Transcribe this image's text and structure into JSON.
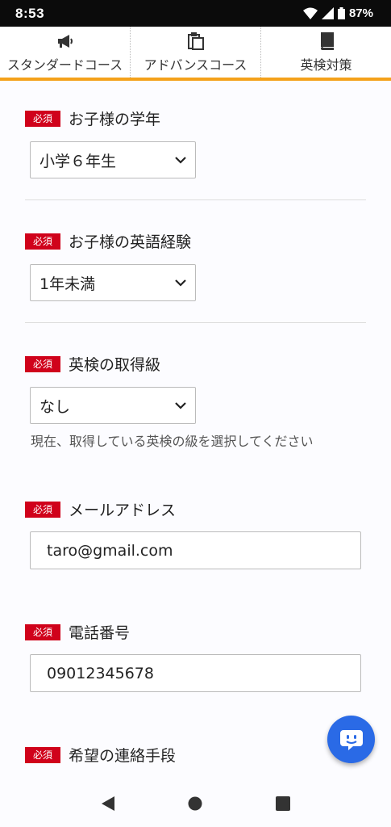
{
  "status_bar": {
    "time": "8:53",
    "battery": "87%"
  },
  "tabs": [
    {
      "label": "スタンダードコース",
      "icon": "megaphone-icon"
    },
    {
      "label": "アドバンスコース",
      "icon": "clipboard-icon"
    },
    {
      "label": "英検対策",
      "icon": "book-icon"
    }
  ],
  "form": {
    "required_label": "必須",
    "grade": {
      "label": "お子様の学年",
      "value": "小学６年生"
    },
    "english_experience": {
      "label": "お子様の英語経験",
      "value": "1年未満"
    },
    "eiken_level": {
      "label": "英検の取得級",
      "value": "なし",
      "help": "現在、取得している英検の級を選択してください"
    },
    "email": {
      "label": "メールアドレス",
      "value": "taro@gmail.com"
    },
    "phone": {
      "label": "電話番号",
      "value": "09012345678"
    },
    "contact_method": {
      "label": "希望の連絡手段"
    }
  },
  "colors": {
    "accent": "#f4a11a",
    "required": "#d0021b",
    "fab": "#2a6ae6"
  }
}
